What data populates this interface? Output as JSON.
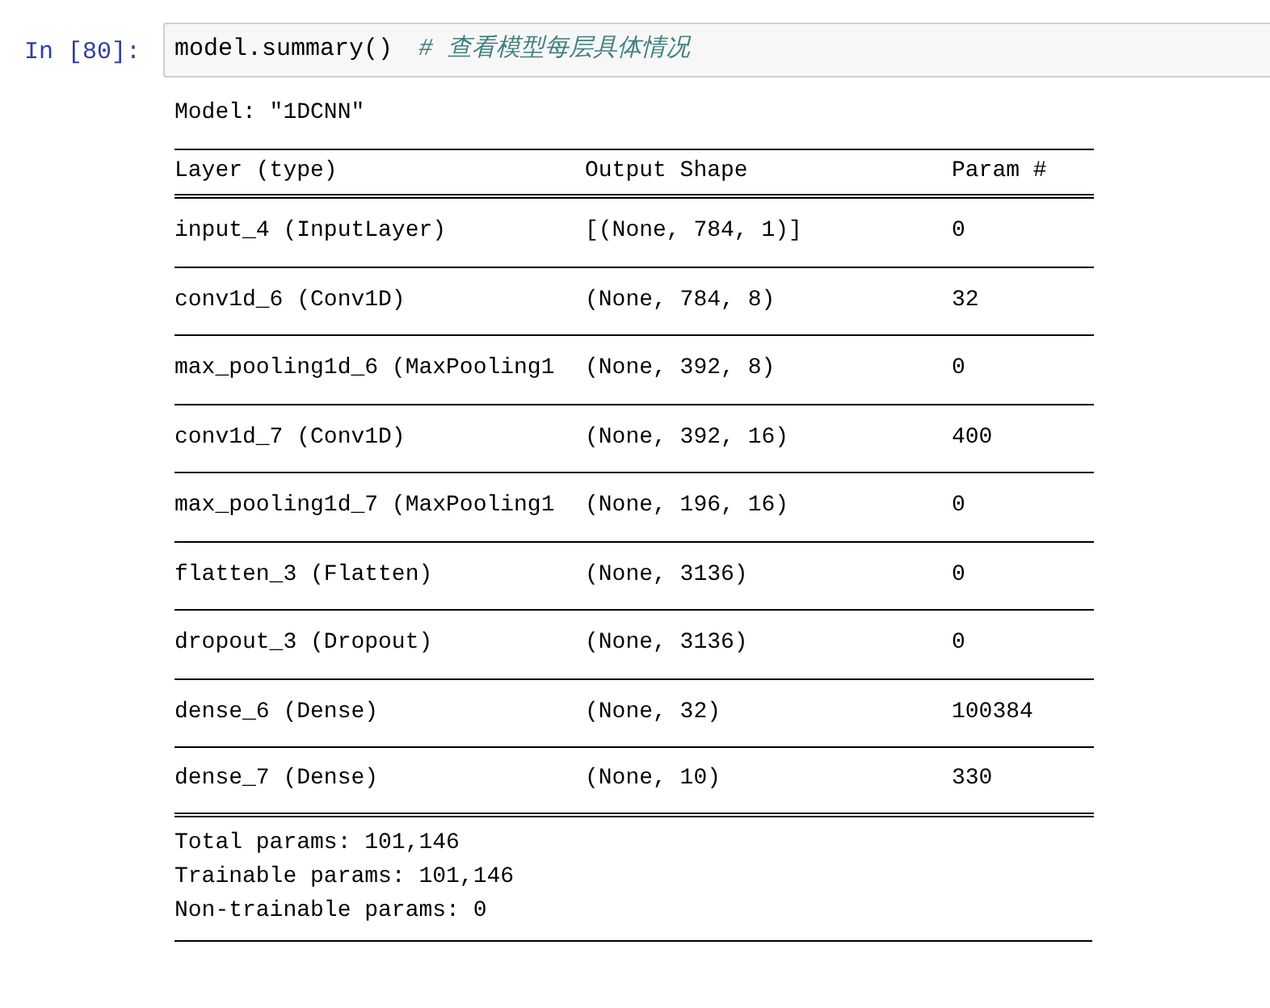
{
  "cell": {
    "prompt": "In [80]:",
    "code": "model.summary()",
    "comment": "# 查看模型每层具体情况"
  },
  "output": {
    "model_line": "Model: \"1DCNN\"",
    "table": {
      "columns": [
        "Layer (type)",
        "Output Shape",
        "Param #"
      ],
      "rows": [
        [
          "input_4 (InputLayer)",
          "[(None, 784, 1)]",
          "0"
        ],
        [
          "conv1d_6 (Conv1D)",
          "(None, 784, 8)",
          "32"
        ],
        [
          "max_pooling1d_6 (MaxPooling1",
          "(None, 392, 8)",
          "0"
        ],
        [
          "conv1d_7 (Conv1D)",
          "(None, 392, 16)",
          "400"
        ],
        [
          "max_pooling1d_7 (MaxPooling1",
          "(None, 196, 16)",
          "0"
        ],
        [
          "flatten_3 (Flatten)",
          "(None, 3136)",
          "0"
        ],
        [
          "dropout_3 (Dropout)",
          "(None, 3136)",
          "0"
        ],
        [
          "dense_6 (Dense)",
          "(None, 32)",
          "100384"
        ],
        [
          "dense_7 (Dense)",
          "(None, 10)",
          "330"
        ]
      ]
    },
    "totals": [
      "Total params: 101,146",
      "Trainable params: 101,146",
      "Non-trainable params: 0"
    ]
  }
}
